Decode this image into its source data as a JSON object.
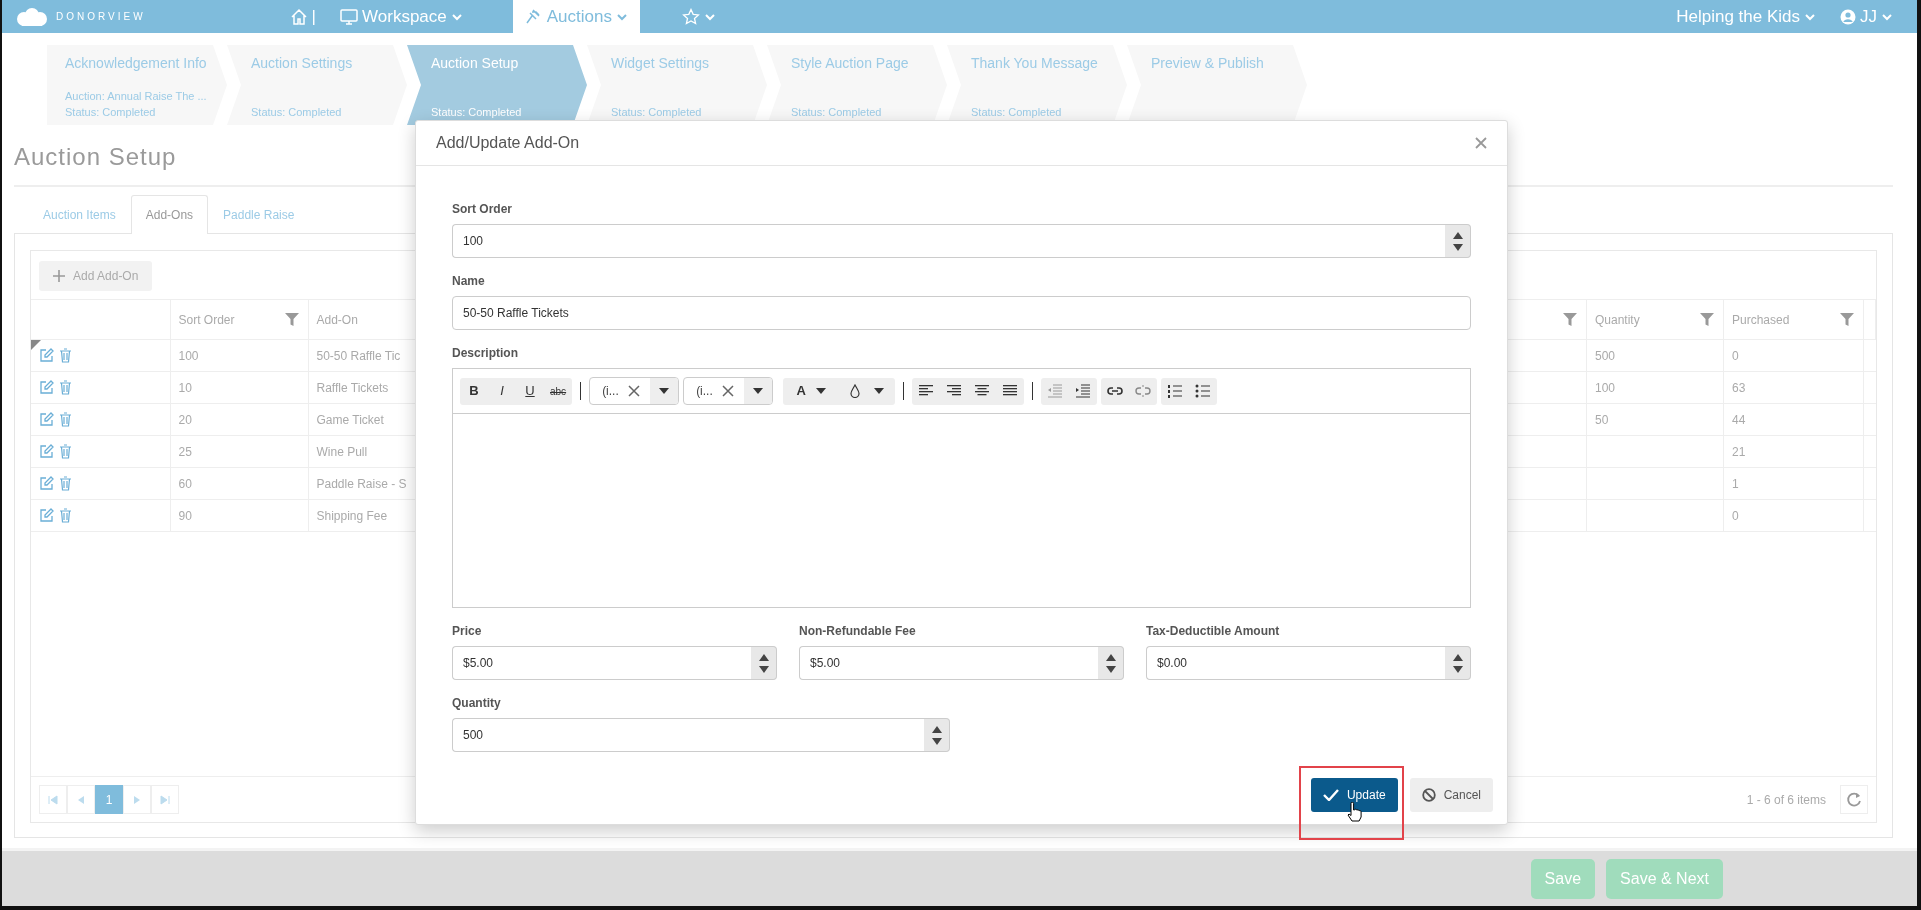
{
  "navbar": {
    "brand": "DONORVIEW",
    "items": [
      {
        "kind": "home",
        "label": "|",
        "selected": false
      },
      {
        "kind": "workspace",
        "label": "Workspace",
        "selected": false
      },
      {
        "kind": "auctions",
        "label": "Auctions",
        "selected": true
      },
      {
        "kind": "favorites",
        "selected": false
      }
    ],
    "org": "Helping the Kids",
    "user": "JJ"
  },
  "wizard": [
    {
      "title": "Acknowledgement Info",
      "lines": [
        "Auction: Annual Raise The ...",
        "Status: Completed"
      ],
      "selected": false
    },
    {
      "title": "Auction Settings",
      "lines": [
        "Status: Completed"
      ],
      "selected": false
    },
    {
      "title": "Auction Setup",
      "lines": [
        "Status: Completed"
      ],
      "selected": true
    },
    {
      "title": "Widget Settings",
      "lines": [
        "Status: Completed"
      ],
      "selected": false
    },
    {
      "title": "Style Auction Page",
      "lines": [
        "Status: Completed"
      ],
      "selected": false
    },
    {
      "title": "Thank You Message",
      "lines": [
        "Status: Completed"
      ],
      "selected": false
    },
    {
      "title": "Preview & Publish",
      "selected": false
    }
  ],
  "page_title": "Auction Setup",
  "tabs": [
    {
      "label": "Auction Items",
      "selected": false
    },
    {
      "label": "Add-Ons",
      "selected": true
    },
    {
      "label": "Paddle Raise",
      "selected": false
    }
  ],
  "add_button": "Add Add-On",
  "table": {
    "columns": [
      {
        "filter": false
      },
      {
        "label": "Sort Order",
        "filter": true
      },
      {
        "label": "Add-On",
        "filter": false
      },
      {
        "filter": true
      },
      {
        "label": "Quantity",
        "filter": true
      },
      {
        "label": "Purchased",
        "filter": true
      }
    ],
    "rows": [
      {
        "sort_order": "100",
        "add_on": "50-50 Raffle Tic",
        "quantity": "500",
        "purchased": "0",
        "selected": true
      },
      {
        "sort_order": "10",
        "add_on": "Raffle Tickets",
        "quantity": "100",
        "purchased": "63",
        "selected": false
      },
      {
        "sort_order": "20",
        "add_on": "Game Ticket",
        "quantity": "50",
        "purchased": "44",
        "selected": false
      },
      {
        "sort_order": "25",
        "add_on": "Wine Pull",
        "purchased": "21",
        "selected": false
      },
      {
        "sort_order": "60",
        "add_on": "Paddle Raise - S",
        "purchased": "1",
        "selected": false
      },
      {
        "sort_order": "90",
        "add_on": "Shipping Fee",
        "purchased": "0",
        "selected": false
      }
    ]
  },
  "pager": {
    "pages": [
      {
        "label": "1",
        "selected": true
      }
    ],
    "info": "1 - 6 of 6 items"
  },
  "modal": {
    "title": "Add/Update Add-On",
    "rows": [
      [
        {
          "kind": "number",
          "label": "Sort Order",
          "value": "100"
        }
      ],
      [
        {
          "kind": "text",
          "label": "Name",
          "value": "50-50 Raffle Tickets"
        }
      ],
      [
        {
          "kind": "editor",
          "label": "Description",
          "format_buttons": [
            "B",
            "I",
            "U",
            "abc"
          ],
          "font_selects": [
            "(i...",
            "(i..."
          ],
          "color_button": "A"
        }
      ],
      [
        {
          "kind": "number",
          "label": "Price",
          "value": "$5.00"
        },
        {
          "kind": "number",
          "label": "Non-Refundable Fee",
          "value": "$5.00"
        },
        {
          "kind": "number",
          "label": "Tax-Deductible Amount",
          "value": "$0.00"
        }
      ],
      [
        {
          "kind": "number",
          "label": "Quantity",
          "value": "500"
        }
      ]
    ],
    "buttons": [
      {
        "kind": "primary",
        "label": "Update",
        "highlighted": true
      },
      {
        "kind": "cancel",
        "label": "Cancel",
        "highlighted": false
      }
    ]
  },
  "footer_buttons": [
    "Save",
    "Save & Next"
  ]
}
